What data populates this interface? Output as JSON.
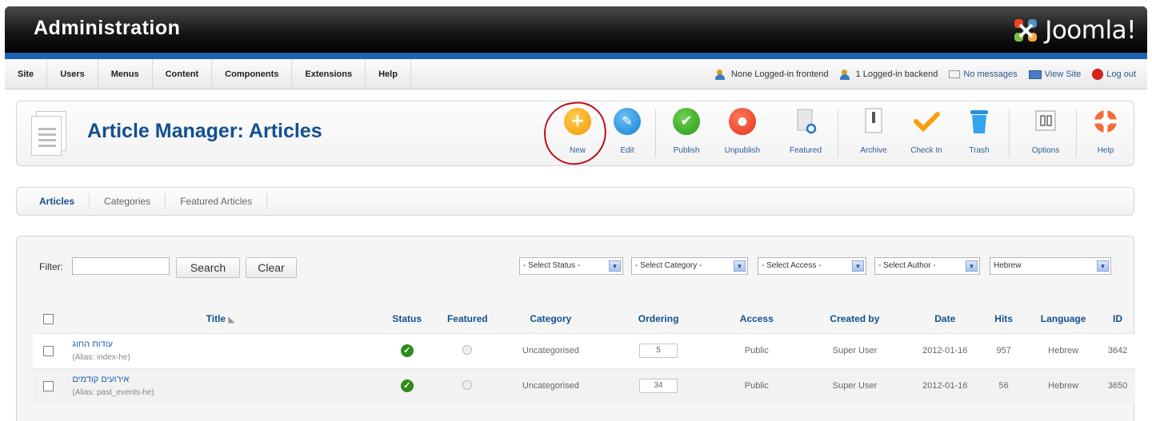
{
  "header": {
    "title": "Administration",
    "logo_text": "Joomla!"
  },
  "menu": [
    "Site",
    "Users",
    "Menus",
    "Content",
    "Components",
    "Extensions",
    "Help"
  ],
  "status": {
    "frontend": "None Logged-in frontend",
    "backend": "1 Logged-in backend",
    "messages": "No messages",
    "view_site": "View Site",
    "logout": "Log out"
  },
  "toolbar": {
    "page_title": "Article Manager: Articles",
    "buttons": [
      "New",
      "Edit",
      "Publish",
      "Unpublish",
      "Featured",
      "Archive",
      "Check In",
      "Trash",
      "Options",
      "Help"
    ]
  },
  "subtabs": [
    "Articles",
    "Categories",
    "Featured Articles"
  ],
  "filters": {
    "filter_label": "Filter:",
    "filter_value": "",
    "search_label": "Search",
    "clear_label": "Clear",
    "selects": [
      "- Select Status -",
      "- Select Category -",
      "- Select Access -",
      "- Select Author -",
      "Hebrew"
    ]
  },
  "table": {
    "columns": [
      "Title",
      "Status",
      "Featured",
      "Category",
      "Ordering",
      "Access",
      "Created by",
      "Date",
      "Hits",
      "Language",
      "ID"
    ],
    "rows": [
      {
        "title": "עודות החוג",
        "alias": "(Alias: index-he)",
        "category": "Uncategorised",
        "ordering": "5",
        "access": "Public",
        "created_by": "Super User",
        "date": "2012-01-16",
        "hits": "957",
        "language": "Hebrew",
        "id": "3642"
      },
      {
        "title": "אירועים קודמים",
        "alias": "(Alias: past_events-he)",
        "category": "Uncategorised",
        "ordering": "34",
        "access": "Public",
        "created_by": "Super User",
        "date": "2012-01-16",
        "hits": "56",
        "language": "Hebrew",
        "id": "3650"
      }
    ]
  },
  "colors": {
    "accent": "#13508f",
    "bluebar": "#1a63b4",
    "annotation": "#c30b1e"
  }
}
